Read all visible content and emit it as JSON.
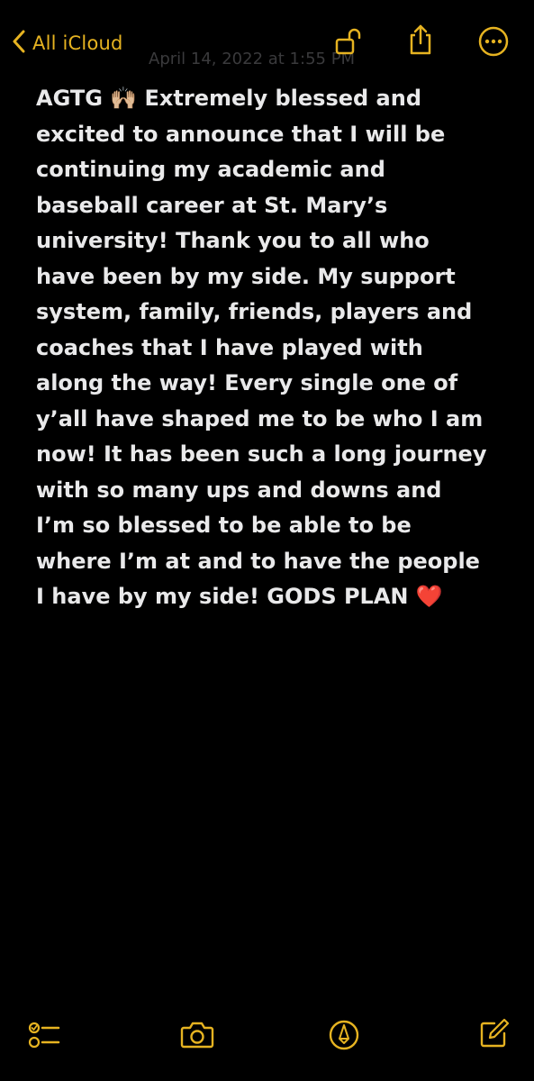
{
  "theme": {
    "accent": "#e6b321",
    "background": "#000000",
    "text": "#e9e9ea"
  },
  "top_bar": {
    "back_label": "All iCloud",
    "timestamp": "April 14, 2022 at 1:55 PM",
    "icons": [
      "chevron-left-icon",
      "unlock-icon",
      "share-icon",
      "more-icon"
    ]
  },
  "note": {
    "text": "AGTG 🙌🏼 Extremely blessed and\nexcited to announce that I will be\ncontinuing my academic and\nbaseball career at St. Mary’s\nuniversity! Thank you to all who\nhave been by my side. My support\nsystem, family, friends, players and\ncoaches that I have played with\nalong the way! Every single one of\ny’all have shaped me to be who I am\nnow! It has been such a long journey\nwith so many ups and downs and\nI’m so blessed to be able to be\nwhere I’m at and to have the people\nI have by my side! GODS PLAN ❤️"
  },
  "bottom_bar": {
    "icons": [
      "checklist-icon",
      "camera-icon",
      "markup-icon",
      "compose-icon"
    ]
  }
}
